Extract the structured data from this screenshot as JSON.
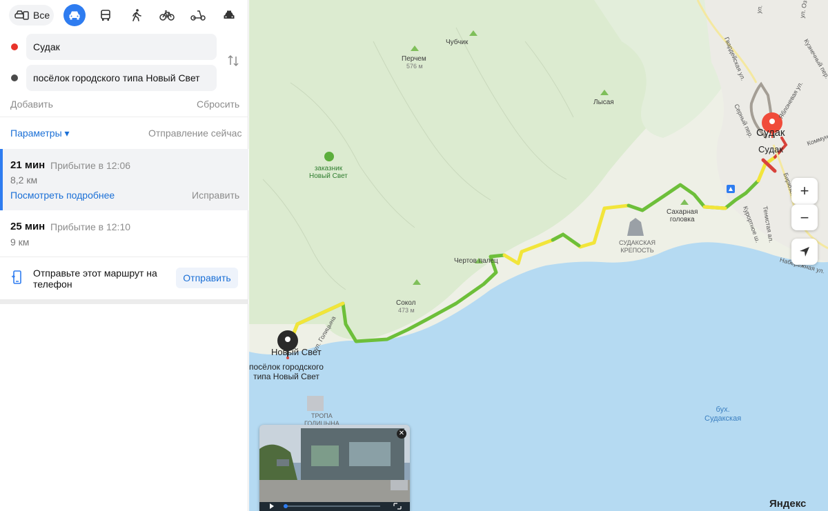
{
  "modes": {
    "all_label": "Все",
    "items": [
      {
        "name": "car",
        "active": true
      },
      {
        "name": "bus",
        "active": false
      },
      {
        "name": "walk",
        "active": false
      },
      {
        "name": "bike",
        "active": false
      },
      {
        "name": "scooter",
        "active": false
      },
      {
        "name": "taxi",
        "active": false
      }
    ]
  },
  "route_points": {
    "from": "Судак",
    "to": "посёлок городского типа Новый Свет",
    "from_color": "#e8332a",
    "to_color": "#4a4a4a"
  },
  "actions": {
    "add": "Добавить",
    "reset": "Сбросить"
  },
  "params": {
    "label": "Параметры ▾",
    "departure": "Отправление сейчас"
  },
  "routes": [
    {
      "time": "21 мин",
      "arrival": "Прибытие в 12:06",
      "distance": "8,2 км",
      "details": "Посмотреть подробнее",
      "fix": "Исправить"
    },
    {
      "time": "25 мин",
      "arrival": "Прибытие в 12:10",
      "distance": "9 км"
    }
  ],
  "send": {
    "text": "Отправьте этот маршрут на телефон",
    "button": "Отправить"
  },
  "map": {
    "labels": {
      "chubchik": "Чубчик",
      "perchem": "Перчем",
      "perchem_h": "576 м",
      "lysaya": "Лысая",
      "zakaznik": "заказник\nНовый Свет",
      "chertov": "Чертов палец",
      "sokol": "Сокол",
      "sokol_h": "473 м",
      "sakharnaya": "Сахарная\nголовка",
      "krepost": "СУДАКСКАЯ\nКРЕПОСТЬ",
      "novy_svet_pin": "Новый Свет",
      "novy_svet_full": "посёлок городского\nтипа Новый Свет",
      "sudak_pin": "Судак",
      "sudak_city": "Судак",
      "bay": "бух.\nСудакская",
      "tropa": "ТРОПА\nГОЛИЦЫНА",
      "st_golitsyna": "ул. Голицына",
      "st_gvard": "Гвардейская ул.",
      "st_kurort": "Курортное ш.",
      "st_biryuz": "Бирюзова",
      "st_naber": "Набережная ул.",
      "st_kommun": "Коммун",
      "st_kuznech": "Кузнечный пер.",
      "st_yablon": "Яблоневая ул.",
      "st_sern": "Серный пер.",
      "st_temnaya": "Тенистая ал.",
      "st_ul": "ул.",
      "st_ul2": "ул. Оз"
    },
    "zoom_in": "+",
    "zoom_out": "−",
    "brand": "Яндекс",
    "colors": {
      "land": "#eef0e6",
      "forest": "#dcebd0",
      "sea": "#b5daf2",
      "route_green": "#6dbf3a",
      "route_yellow": "#f2e53a",
      "route_red": "#d8423a",
      "alt_route": "#a49e95"
    }
  }
}
